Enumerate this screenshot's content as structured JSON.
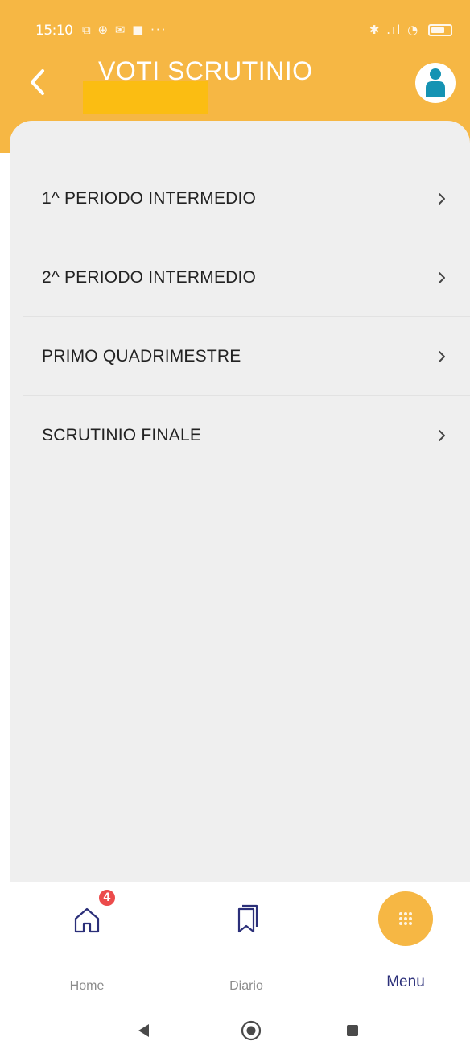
{
  "statusbar": {
    "time": "15:10",
    "left_icons": "⧉ ⊕ ✉ ■ ···",
    "right_icons": "✱ .ıl ◔"
  },
  "header": {
    "title": "VOTI SCRUTINIO",
    "back_icon": "chevron-left-icon",
    "avatar_icon": "user-icon",
    "accent_color": "#f6b744"
  },
  "menu": {
    "items": [
      {
        "label": "1^ PERIODO INTERMEDIO"
      },
      {
        "label": "2^ PERIODO INTERMEDIO"
      },
      {
        "label": "PRIMO QUADRIMESTRE"
      },
      {
        "label": "SCRUTINIO FINALE"
      }
    ]
  },
  "bottom_nav": {
    "home": {
      "label": "Home",
      "badge": "4",
      "icon": "home-icon"
    },
    "diario": {
      "label": "Diario",
      "icon": "bookmark-icon"
    },
    "menu": {
      "label": "Menu",
      "icon": "grid-dots-icon",
      "active_color": "#2b2f79"
    }
  },
  "system_nav": [
    "back-triangle-icon",
    "home-circle-icon",
    "recents-square-icon"
  ]
}
